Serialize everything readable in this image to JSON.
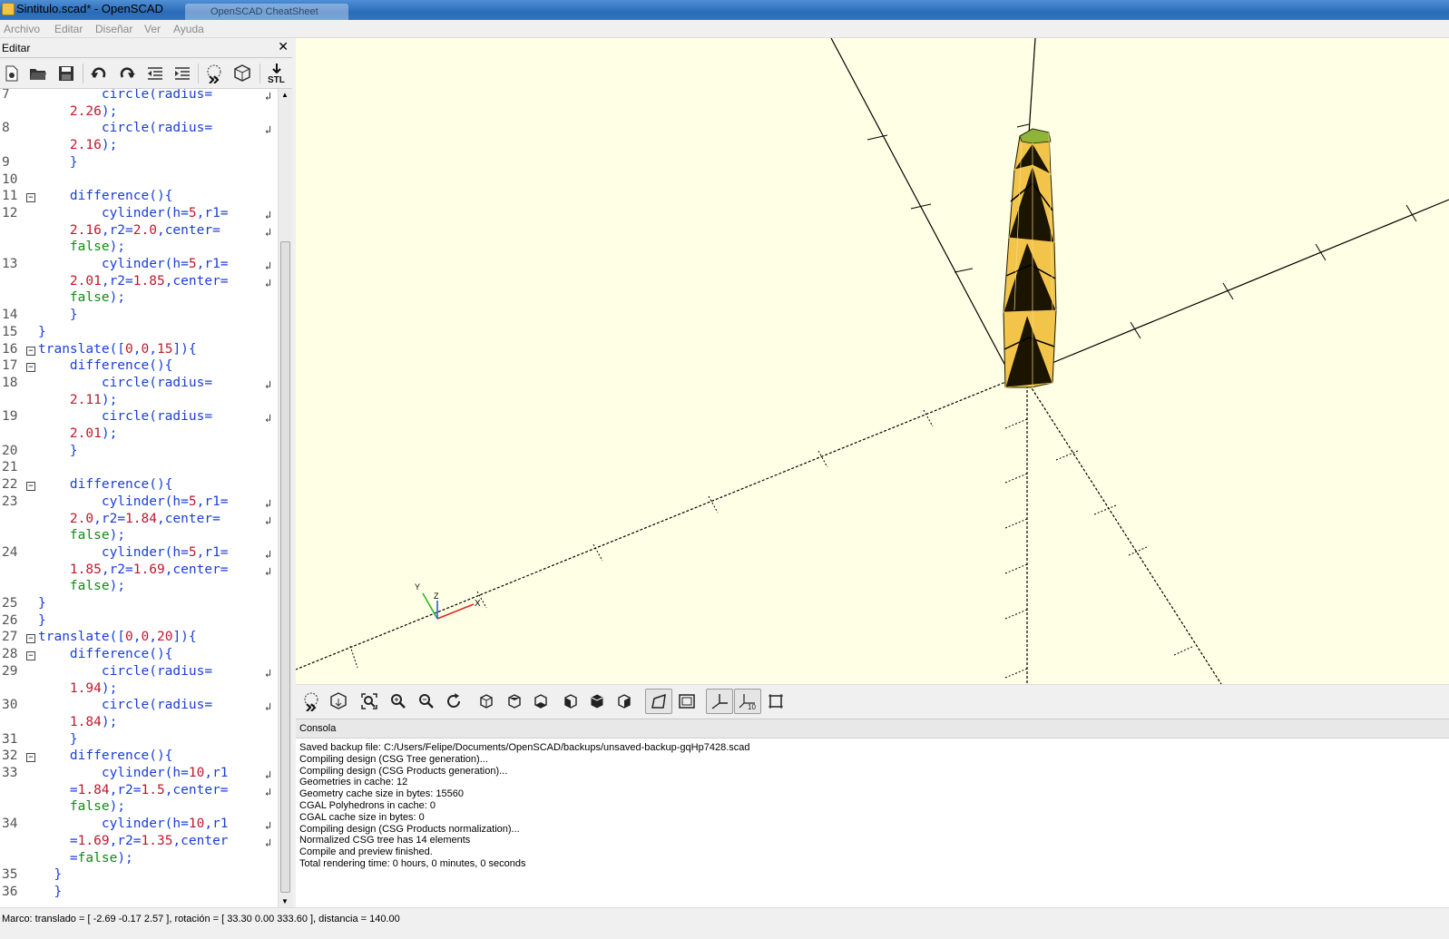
{
  "window": {
    "title": "Sintitulo.scad* - OpenSCAD",
    "second_tab": "OpenSCAD CheatSheet"
  },
  "menu": [
    "Archivo",
    "Editar",
    "Diseñar",
    "Ver",
    "Ayuda"
  ],
  "editor": {
    "panel_title": "Editar",
    "close_label": "✕",
    "toolbar_icons": [
      "new-file-icon",
      "open-file-icon",
      "save-icon",
      "undo-icon",
      "redo-icon",
      "unindent-icon",
      "indent-icon",
      "preview-icon",
      "render-icon",
      "export-stl-icon"
    ],
    "stl_label": "STL",
    "lines": [
      {
        "num": "7",
        "segments": [
          {
            "t": "        circle(radius=",
            "c": "kw"
          }
        ],
        "wrap": true
      },
      {
        "num": "",
        "segments": [
          {
            "t": "    ",
            "c": ""
          },
          {
            "t": "2.26",
            "c": "nm"
          },
          {
            "t": ");",
            "c": "kw"
          }
        ]
      },
      {
        "num": "8",
        "segments": [
          {
            "t": "        circle(radius=",
            "c": "kw"
          }
        ],
        "wrap": true
      },
      {
        "num": "",
        "segments": [
          {
            "t": "    ",
            "c": ""
          },
          {
            "t": "2.16",
            "c": "nm"
          },
          {
            "t": ");",
            "c": "kw"
          }
        ]
      },
      {
        "num": "9",
        "segments": [
          {
            "t": "    }",
            "c": "kw"
          }
        ]
      },
      {
        "num": "10",
        "segments": []
      },
      {
        "num": "11",
        "segments": [
          {
            "t": "    difference(){",
            "c": "kw"
          }
        ],
        "fold": "minus"
      },
      {
        "num": "12",
        "segments": [
          {
            "t": "        cylinder(h=",
            "c": "kw"
          },
          {
            "t": "5",
            "c": "nm"
          },
          {
            "t": ",r1=",
            "c": "kw"
          }
        ],
        "wrap": true
      },
      {
        "num": "",
        "segments": [
          {
            "t": "    ",
            "c": ""
          },
          {
            "t": "2.16",
            "c": "nm"
          },
          {
            "t": ",r2=",
            "c": "kw"
          },
          {
            "t": "2.0",
            "c": "nm"
          },
          {
            "t": ",center=",
            "c": "kw"
          }
        ],
        "wrap": true
      },
      {
        "num": "",
        "segments": [
          {
            "t": "    ",
            "c": ""
          },
          {
            "t": "false",
            "c": "fa"
          },
          {
            "t": ");",
            "c": "kw"
          }
        ]
      },
      {
        "num": "13",
        "segments": [
          {
            "t": "        cylinder(h=",
            "c": "kw"
          },
          {
            "t": "5",
            "c": "nm"
          },
          {
            "t": ",r1=",
            "c": "kw"
          }
        ],
        "wrap": true
      },
      {
        "num": "",
        "segments": [
          {
            "t": "    ",
            "c": ""
          },
          {
            "t": "2.01",
            "c": "nm"
          },
          {
            "t": ",r2=",
            "c": "kw"
          },
          {
            "t": "1.85",
            "c": "nm"
          },
          {
            "t": ",center=",
            "c": "kw"
          }
        ],
        "wrap": true
      },
      {
        "num": "",
        "segments": [
          {
            "t": "    ",
            "c": ""
          },
          {
            "t": "false",
            "c": "fa"
          },
          {
            "t": ");",
            "c": "kw"
          }
        ]
      },
      {
        "num": "14",
        "segments": [
          {
            "t": "    }",
            "c": "kw"
          }
        ]
      },
      {
        "num": "15",
        "segments": [
          {
            "t": "}",
            "c": "kw"
          }
        ]
      },
      {
        "num": "16",
        "segments": [
          {
            "t": "translate([",
            "c": "kw"
          },
          {
            "t": "0",
            "c": "nm"
          },
          {
            "t": ",",
            "c": "kw"
          },
          {
            "t": "0",
            "c": "nm"
          },
          {
            "t": ",",
            "c": "kw"
          },
          {
            "t": "15",
            "c": "nm"
          },
          {
            "t": "]){",
            "c": "kw"
          }
        ],
        "fold": "minus"
      },
      {
        "num": "17",
        "segments": [
          {
            "t": "    difference(){",
            "c": "kw"
          }
        ],
        "fold": "minus"
      },
      {
        "num": "18",
        "segments": [
          {
            "t": "        circle(radius=",
            "c": "kw"
          }
        ],
        "wrap": true
      },
      {
        "num": "",
        "segments": [
          {
            "t": "    ",
            "c": ""
          },
          {
            "t": "2.11",
            "c": "nm"
          },
          {
            "t": ");",
            "c": "kw"
          }
        ]
      },
      {
        "num": "19",
        "segments": [
          {
            "t": "        circle(radius=",
            "c": "kw"
          }
        ],
        "wrap": true
      },
      {
        "num": "",
        "segments": [
          {
            "t": "    ",
            "c": ""
          },
          {
            "t": "2.01",
            "c": "nm"
          },
          {
            "t": ");",
            "c": "kw"
          }
        ]
      },
      {
        "num": "20",
        "segments": [
          {
            "t": "    }",
            "c": "kw"
          }
        ]
      },
      {
        "num": "21",
        "segments": []
      },
      {
        "num": "22",
        "segments": [
          {
            "t": "    difference(){",
            "c": "kw"
          }
        ],
        "fold": "minus"
      },
      {
        "num": "23",
        "segments": [
          {
            "t": "        cylinder(h=",
            "c": "kw"
          },
          {
            "t": "5",
            "c": "nm"
          },
          {
            "t": ",r1=",
            "c": "kw"
          }
        ],
        "wrap": true
      },
      {
        "num": "",
        "segments": [
          {
            "t": "    ",
            "c": ""
          },
          {
            "t": "2.0",
            "c": "nm"
          },
          {
            "t": ",r2=",
            "c": "kw"
          },
          {
            "t": "1.84",
            "c": "nm"
          },
          {
            "t": ",center=",
            "c": "kw"
          }
        ],
        "wrap": true
      },
      {
        "num": "",
        "segments": [
          {
            "t": "    ",
            "c": ""
          },
          {
            "t": "false",
            "c": "fa"
          },
          {
            "t": ");",
            "c": "kw"
          }
        ]
      },
      {
        "num": "24",
        "segments": [
          {
            "t": "        cylinder(h=",
            "c": "kw"
          },
          {
            "t": "5",
            "c": "nm"
          },
          {
            "t": ",r1=",
            "c": "kw"
          }
        ],
        "wrap": true
      },
      {
        "num": "",
        "segments": [
          {
            "t": "    ",
            "c": ""
          },
          {
            "t": "1.85",
            "c": "nm"
          },
          {
            "t": ",r2=",
            "c": "kw"
          },
          {
            "t": "1.69",
            "c": "nm"
          },
          {
            "t": ",center=",
            "c": "kw"
          }
        ],
        "wrap": true
      },
      {
        "num": "",
        "segments": [
          {
            "t": "    ",
            "c": ""
          },
          {
            "t": "false",
            "c": "fa"
          },
          {
            "t": ");",
            "c": "kw"
          }
        ]
      },
      {
        "num": "25",
        "segments": [
          {
            "t": "}",
            "c": "kw"
          }
        ]
      },
      {
        "num": "26",
        "segments": [
          {
            "t": "}",
            "c": "kw"
          }
        ]
      },
      {
        "num": "27",
        "segments": [
          {
            "t": "translate([",
            "c": "kw"
          },
          {
            "t": "0",
            "c": "nm"
          },
          {
            "t": ",",
            "c": "kw"
          },
          {
            "t": "0",
            "c": "nm"
          },
          {
            "t": ",",
            "c": "kw"
          },
          {
            "t": "20",
            "c": "nm"
          },
          {
            "t": "]){",
            "c": "kw"
          }
        ],
        "fold": "minus"
      },
      {
        "num": "28",
        "segments": [
          {
            "t": "    difference(){",
            "c": "kw"
          }
        ],
        "fold": "minus"
      },
      {
        "num": "29",
        "segments": [
          {
            "t": "        circle(radius=",
            "c": "kw"
          }
        ],
        "wrap": true
      },
      {
        "num": "",
        "segments": [
          {
            "t": "    ",
            "c": ""
          },
          {
            "t": "1.94",
            "c": "nm"
          },
          {
            "t": ");",
            "c": "kw"
          }
        ]
      },
      {
        "num": "30",
        "segments": [
          {
            "t": "        circle(radius=",
            "c": "kw"
          }
        ],
        "wrap": true
      },
      {
        "num": "",
        "segments": [
          {
            "t": "    ",
            "c": ""
          },
          {
            "t": "1.84",
            "c": "nm"
          },
          {
            "t": ");",
            "c": "kw"
          }
        ]
      },
      {
        "num": "31",
        "segments": [
          {
            "t": "    }",
            "c": "kw"
          }
        ]
      },
      {
        "num": "32",
        "segments": [
          {
            "t": "    difference(){",
            "c": "kw"
          }
        ],
        "fold": "minus"
      },
      {
        "num": "33",
        "segments": [
          {
            "t": "        cylinder(h=",
            "c": "kw"
          },
          {
            "t": "10",
            "c": "nm"
          },
          {
            "t": ",r1",
            "c": "kw"
          }
        ],
        "wrap": true
      },
      {
        "num": "",
        "segments": [
          {
            "t": "    =",
            "c": "kw"
          },
          {
            "t": "1.84",
            "c": "nm"
          },
          {
            "t": ",r2=",
            "c": "kw"
          },
          {
            "t": "1.5",
            "c": "nm"
          },
          {
            "t": ",center=",
            "c": "kw"
          }
        ],
        "wrap": true
      },
      {
        "num": "",
        "segments": [
          {
            "t": "    ",
            "c": ""
          },
          {
            "t": "false",
            "c": "fa"
          },
          {
            "t": ");",
            "c": "kw"
          }
        ]
      },
      {
        "num": "34",
        "segments": [
          {
            "t": "        cylinder(h=",
            "c": "kw"
          },
          {
            "t": "10",
            "c": "nm"
          },
          {
            "t": ",r1",
            "c": "kw"
          }
        ],
        "wrap": true
      },
      {
        "num": "",
        "segments": [
          {
            "t": "    =",
            "c": "kw"
          },
          {
            "t": "1.69",
            "c": "nm"
          },
          {
            "t": ",r2=",
            "c": "kw"
          },
          {
            "t": "1.35",
            "c": "nm"
          },
          {
            "t": ",center",
            "c": "kw"
          }
        ],
        "wrap": true
      },
      {
        "num": "",
        "segments": [
          {
            "t": "    =",
            "c": "kw"
          },
          {
            "t": "false",
            "c": "fa"
          },
          {
            "t": ");",
            "c": "kw"
          }
        ]
      },
      {
        "num": "35",
        "segments": [
          {
            "t": "  }",
            "c": "kw"
          }
        ]
      },
      {
        "num": "36",
        "segments": [
          {
            "t": "  }",
            "c": "kw"
          }
        ]
      }
    ]
  },
  "viewport": {
    "background": "#ffffe5",
    "model_fill": "#f2c44a",
    "axis_labels": {
      "x": "X",
      "y": "Y",
      "z": "Z"
    },
    "axis_x_color": "#e02020",
    "axis_y_color": "#20b020",
    "axis_z_color": "#2050e0"
  },
  "view_toolbar": {
    "icons": [
      "preview-icon",
      "render-icon",
      "zoom-all-icon",
      "zoom-in-icon",
      "zoom-out-icon",
      "reset-view-icon",
      "view-right-icon",
      "view-top-icon",
      "view-bottom-icon",
      "view-left-icon",
      "view-front-icon",
      "view-back-icon",
      "perspective-icon",
      "orthogonal-icon",
      "show-axes-icon",
      "show-scale-markers-icon",
      "show-edges-icon"
    ],
    "scale_label": "10"
  },
  "console": {
    "title": "Consola",
    "lines": [
      "Saved backup file: C:/Users/Felipe/Documents/OpenSCAD/backups/unsaved-backup-gqHp7428.scad",
      "Compiling design (CSG Tree generation)...",
      "Compiling design (CSG Products generation)...",
      "Geometries in cache: 12",
      "Geometry cache size in bytes: 15560",
      "CGAL Polyhedrons in cache: 0",
      "CGAL cache size in bytes: 0",
      "Compiling design (CSG Products normalization)...",
      "Normalized CSG tree has 14 elements",
      "Compile and preview finished.",
      "Total rendering time: 0 hours, 0 minutes, 0 seconds"
    ]
  },
  "status": "Marco: translado = [ -2.69 -0.17 2.57 ], rotación = [ 33.30 0.00 333.60 ], distancia = 140.00"
}
